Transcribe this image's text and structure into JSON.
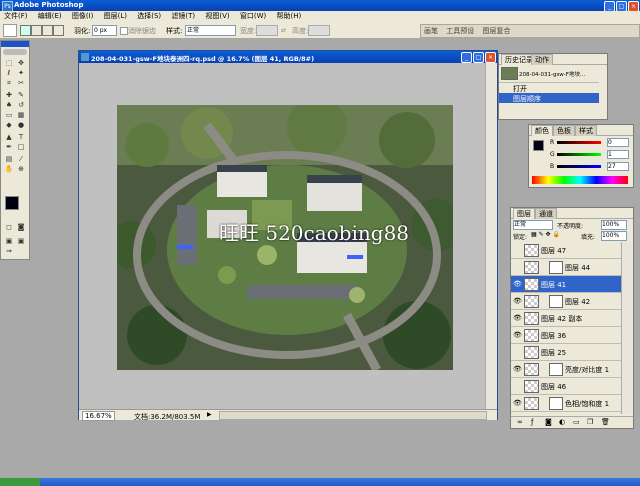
{
  "app": {
    "title": "Adobe Photoshop"
  },
  "menu": [
    "文件(F)",
    "编辑(E)",
    "图像(I)",
    "图层(L)",
    "选择(S)",
    "滤镜(T)",
    "视图(V)",
    "窗口(W)",
    "帮助(H)"
  ],
  "options": {
    "feather_label": "羽化:",
    "feather_value": "0 px",
    "antialias_label": "消除锯齿",
    "style_label": "样式:",
    "style_value": "正常",
    "width_label": "宽度:",
    "height_label": "高度:"
  },
  "palette_well": [
    "画笔",
    "工具预设",
    "图层复合"
  ],
  "document": {
    "title": "208-04-031-gsw-F地块泰洲四-rq.psd @ 16.7% (图层 41, RGB/8#)",
    "zoom": "16.67%",
    "doc_size": "文档:36.2M/803.5M",
    "watermark": "旺旺  520caobing88"
  },
  "history": {
    "tab": "历史记录",
    "tab2": "动作",
    "snapshot": "208-04-031-gsw-F地块...",
    "items": [
      "打开",
      "图层顺序"
    ]
  },
  "color": {
    "tabs": [
      "颜色",
      "色板",
      "样式"
    ],
    "R": "0",
    "G": "1",
    "B": "27"
  },
  "layers": {
    "tabs": [
      "图层",
      "通道"
    ],
    "blend": "正常",
    "opacity_label": "不透明度:",
    "opacity": "100%",
    "lock_label": "锁定:",
    "fill_label": "填充:",
    "fill": "100%",
    "rows": [
      {
        "name": "图层 47",
        "eye": false,
        "mask": false,
        "sel": false
      },
      {
        "name": "图层 44",
        "eye": false,
        "mask": true,
        "sel": false
      },
      {
        "name": "图层 41",
        "eye": true,
        "mask": false,
        "sel": true
      },
      {
        "name": "图层 42",
        "eye": true,
        "mask": true,
        "sel": false
      },
      {
        "name": "图层 42 副本",
        "eye": true,
        "mask": false,
        "sel": false
      },
      {
        "name": "图层 36",
        "eye": true,
        "mask": false,
        "sel": false
      },
      {
        "name": "图层 25",
        "eye": false,
        "mask": false,
        "sel": false
      },
      {
        "name": "亮度/对比度 1",
        "eye": true,
        "mask": true,
        "sel": false
      },
      {
        "name": "图层 46",
        "eye": false,
        "mask": false,
        "sel": false
      },
      {
        "name": "色相/饱和度 1",
        "eye": true,
        "mask": true,
        "sel": false
      }
    ]
  },
  "colors": {
    "fg": "#000010",
    "bg": "#ffffff",
    "accent": "#1d52c8"
  }
}
